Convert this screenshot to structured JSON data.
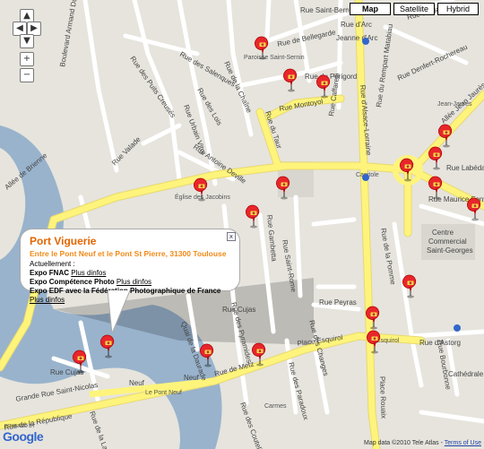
{
  "map_types": {
    "map": "Map",
    "satellite": "Satellite",
    "hybrid": "Hybrid",
    "selected": "Map"
  },
  "controls": {
    "pan_up": "▲",
    "pan_left": "◀",
    "pan_right": "▶",
    "pan_down": "▼",
    "zoom_in": "+",
    "zoom_out": "−"
  },
  "streets": {
    "armand_duportal": "Boulevard Armand Duportal",
    "bellegarde": "Rue de Bellegarde",
    "saint_bernard": "Rue Saint-Bernard",
    "rue_arc": "Rue d'Arc",
    "bayard": "Rue de Bayard",
    "denfert": "Rue Denfert-Rochereau",
    "salenques": "Rue des Salenques",
    "perigord": "Rue du Périgord",
    "remparts": "Rue du Rempart Matabiau",
    "caffarelli": "Rue Caffarelli",
    "urbain_vitry": "Rue Urbain Vitry",
    "lois": "Rue des Lois",
    "chaine": "Rue de la Chaîne",
    "puits_creuses": "Rue des Puits Creusés",
    "montoyol": "Rue Montoyol",
    "taur": "Rue du Taur",
    "jeanne_darc": "Jeanne d'Arc",
    "alsace_lorraine": "Rue d'Alsace-Lorraine",
    "allee_jean_jaures": "Allée Jean Jaurès",
    "allees_brienne": "Allées de Brienne",
    "velane": "Rue Valade",
    "antoine_deville": "Rue Antoine Deville",
    "rue_lois_2": "Rue des Lois",
    "labeda": "Rue Labéda",
    "fonvielle": "Rue Maurice Fonvielle",
    "centre": "Centre",
    "commercial": "Commercial",
    "saint_georges": "Saint-Georges",
    "gambetta": "Rue Gambetta",
    "saint_rome": "Rue Saint-Rome",
    "peyras": "Rue Peyras",
    "pomme": "Rue de la Pomme",
    "astorg": "Rue d'Astorg",
    "esquirol": "Place Esquirol",
    "rue_metz": "Rue de Metz",
    "place_rouaix": "Place Rouaix",
    "cujas": "Rue Cujas",
    "cujas_2": "Rue Cujas",
    "pyramides": "Rue des Pyramides",
    "changes": "Rue des Changes",
    "quai_daurade": "Quai de la Daurade",
    "bourbonne": "Rue Bourbonne",
    "grande_nicolas": "Grande Rue Saint-Nicolas",
    "republique": "Rue de la République",
    "neuf": "Neuf",
    "neuf_2": "Neuf",
    "laque": "Rue de la Laque",
    "paradoux": "Rue des Paradoux",
    "couteliers": "Rue des Couteliers",
    "cathedrale": "Cathédrale St-Étienne",
    "brienne": "Allée de Brienne"
  },
  "pois": {
    "paroisse": "Paroisse Saint-Sernin",
    "eglise_jacobins": "Église des Jacobins",
    "capitole": "Capitole",
    "pont_neuf": "Le Pont Neuf",
    "jean_jaures": "Jean-Jaurès",
    "esquirol_metro": "Esquirol",
    "carmes": "Carmes"
  },
  "info_window": {
    "title": "Port Viguerie",
    "subtitle": "Entre le Pont Neuf et le Pont St Pierre, 31300 Toulouse",
    "currently": "Actuellement :",
    "lines": [
      {
        "name": "Expo FNAC",
        "link": "Plus dinfos"
      },
      {
        "name": "Expo Compétence Photo",
        "link": "Plus dinfos"
      },
      {
        "name": "Expo EDF avec la Fédération Photographique de France",
        "link": "Plus dinfos"
      }
    ],
    "close": "x"
  },
  "footer": {
    "powered_by": "POWERED BY",
    "logo": "Google",
    "map_data": "Map data ©2010 Tele Atlas -",
    "terms": "Terms of Use"
  },
  "colors": {
    "road_yellow": "#fef47c",
    "road_white": "#ffffff",
    "water": "#99b3cc",
    "land": "#e6e4dd",
    "marker_red": "#e8262b",
    "title_orange": "#e36500"
  },
  "markers": {
    "count": 21,
    "icon": "camera-marker-icon"
  }
}
